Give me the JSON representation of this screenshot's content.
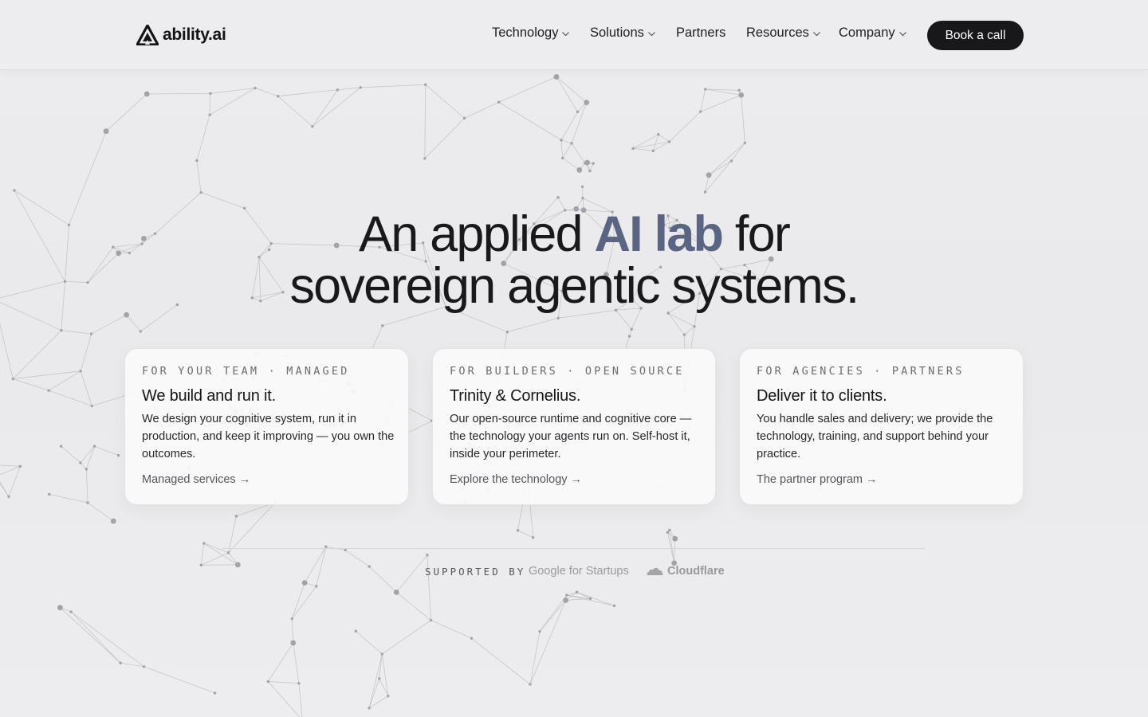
{
  "brand": {
    "name": "ability.ai",
    "logo_icon": "triangle-logo-icon"
  },
  "nav": {
    "items": [
      {
        "label": "Technology",
        "has_dropdown": true
      },
      {
        "label": "Solutions",
        "has_dropdown": true
      },
      {
        "label": "Partners",
        "has_dropdown": false
      },
      {
        "label": "Resources",
        "has_dropdown": true
      },
      {
        "label": "Company",
        "has_dropdown": true
      }
    ],
    "cta": "Book a call"
  },
  "hero": {
    "line1_pre": "An applied ",
    "line1_accent": "AI lab",
    "line1_post": " for",
    "line2": "sovereign agentic systems."
  },
  "cards": [
    {
      "eyebrow": "FOR YOUR TEAM · MANAGED",
      "title": "We build and run it.",
      "body": "We design your cognitive system, run it in production, and keep it improving — you own the outcomes.",
      "link": "Managed services →"
    },
    {
      "eyebrow": "FOR BUILDERS · OPEN SOURCE",
      "title": "Trinity & Cornelius.",
      "body": "Our open-source runtime and cognitive core — the technology your agents run on. Self-host it, inside your perimeter.",
      "link": "Explore the technology →"
    },
    {
      "eyebrow": "FOR AGENCIES · PARTNERS",
      "title": "Deliver it to clients.",
      "body": "You handle sales and delivery; we provide the technology, training, and support behind your practice.",
      "link": "The partner program →"
    }
  ],
  "support": {
    "label": "SUPPORTED BY",
    "sponsors": [
      "Google for Startups",
      "Cloudflare"
    ]
  },
  "colors": {
    "accent": "#5a6583",
    "cta_bg": "#18181a",
    "page_bg": "#ececee"
  }
}
